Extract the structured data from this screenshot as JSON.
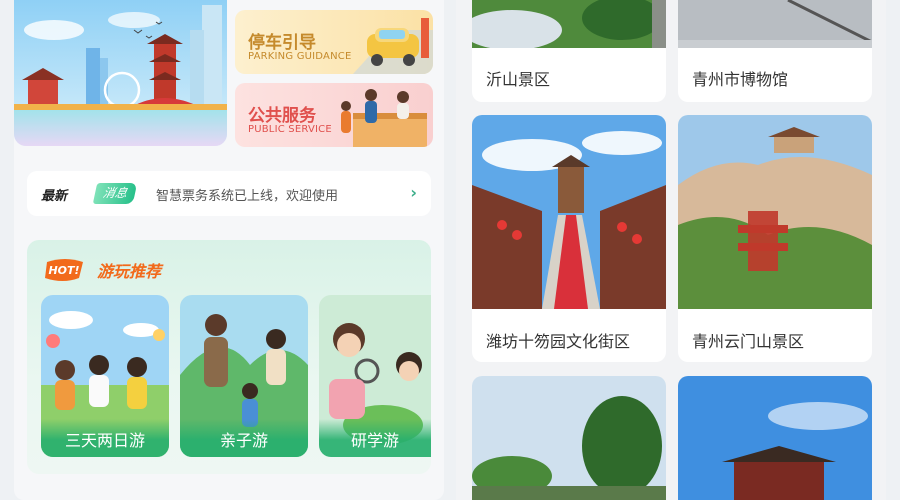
{
  "services": {
    "parking": {
      "title": "停车引导",
      "subtitle": "PARKING GUIDANCE"
    },
    "public": {
      "title": "公共服务",
      "subtitle": "PUBLIC SERVICE"
    }
  },
  "news": {
    "latest_label": "最新",
    "tag": "消息",
    "message": "智慧票务系统已上线，欢迎使用",
    "chevron": "›"
  },
  "recommend": {
    "hot_badge": "HOT!",
    "title": "游玩推荐",
    "cards": [
      {
        "label": "三天两日游"
      },
      {
        "label": "亲子游"
      },
      {
        "label": "研学游"
      }
    ]
  },
  "spots": [
    {
      "name": "沂山景区"
    },
    {
      "name": "青州市博物馆"
    },
    {
      "name": "潍坊十笏园文化街区"
    },
    {
      "name": "青州云门山景区"
    }
  ],
  "colors": {
    "accent_green": "#27c08a",
    "hot_orange": "#f26a1b",
    "parking_gold": "#c58a2c",
    "public_red": "#e0504d"
  }
}
